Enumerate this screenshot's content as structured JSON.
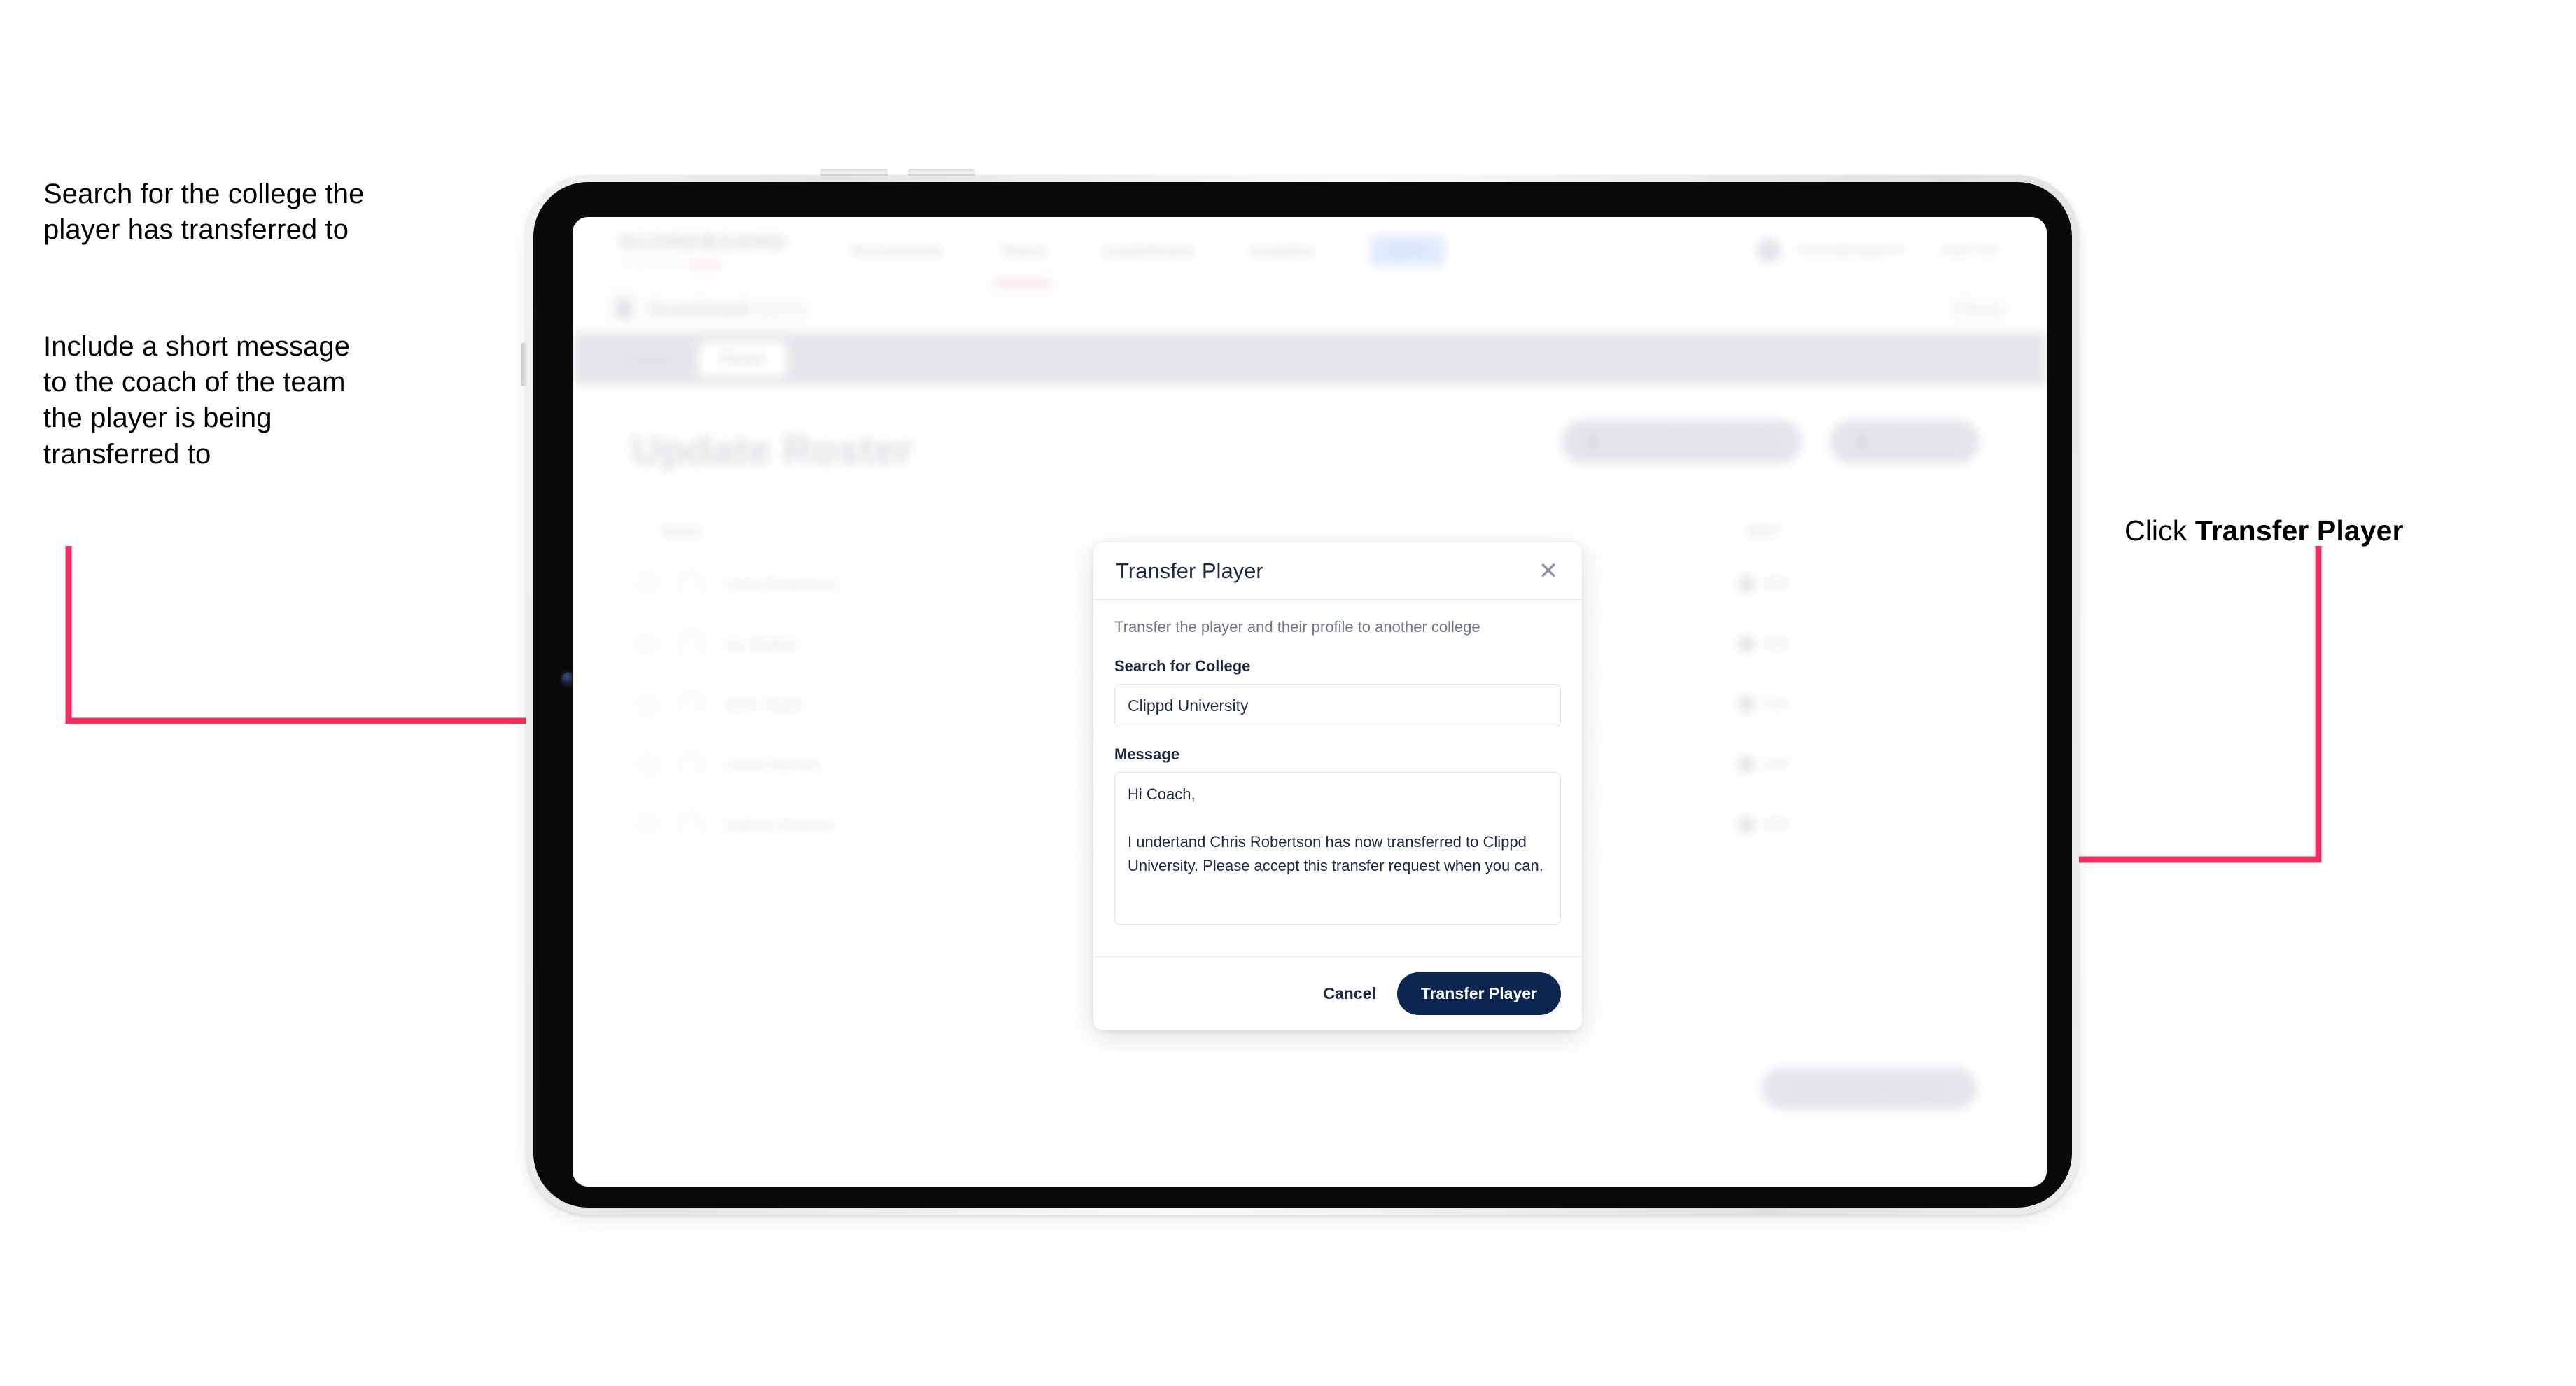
{
  "annotations": {
    "left_1": "Search for the college the\nplayer has transferred to",
    "left_2": "Include a short message\nto the coach of the team\nthe player is being\ntransferred to",
    "right_prefix": "Click ",
    "right_bold": "Transfer Player"
  },
  "colors": {
    "accent_pink": "#EF3061",
    "primary_navy": "#0C2651",
    "text_dark": "#1D2A44",
    "muted": "#6D7788"
  },
  "app": {
    "brand": {
      "word": "SCOREBOARD",
      "sub_text": "Powered by",
      "sub_pill": "clippd"
    },
    "nav_links": [
      {
        "label": "Tournaments",
        "active": false
      },
      {
        "label": "Teams",
        "active": true
      },
      {
        "label": "Leaderboard",
        "active": false
      },
      {
        "label": "Analytics",
        "active": false
      }
    ],
    "nav_chip": "Admin",
    "nav_email": "coach@clippd.io",
    "nav_signout": "Sign Out",
    "subbar": {
      "title": "Scoreboard",
      "title_suffix": "Admin",
      "right": "Clippd"
    },
    "tabs": [
      {
        "label": "Details",
        "active": false
      },
      {
        "label": "Roster",
        "active": true
      }
    ],
    "page_title": "Update Roster",
    "top_actions": [
      {
        "label": "Request Player Transfer"
      },
      {
        "label": "Add Player"
      }
    ],
    "table": {
      "headers": {
        "name": "Name",
        "edit": "EDIT"
      },
      "rows": [
        {
          "name": "Chris Robertson",
          "edit": "Edit"
        },
        {
          "name": "Ian Walker",
          "edit": "Edit"
        },
        {
          "name": "John Taylor",
          "edit": "Edit"
        },
        {
          "name": "Lewis Barnes",
          "edit": "Edit"
        },
        {
          "name": "Nathan Holmes",
          "edit": "Edit"
        }
      ]
    },
    "bottom_cta": "Save Roster Changes"
  },
  "modal": {
    "title": "Transfer Player",
    "close_icon": "close-icon",
    "description": "Transfer the player and their profile to another college",
    "college_label": "Search for College",
    "college_value": "Clippd University",
    "college_placeholder": "Search for College",
    "message_label": "Message",
    "message_value": "Hi Coach,\n\nI undertand Chris Robertson has now transferred to Clippd University. Please accept this transfer request when you can.",
    "message_placeholder": "Message",
    "cancel_label": "Cancel",
    "submit_label": "Transfer Player"
  }
}
